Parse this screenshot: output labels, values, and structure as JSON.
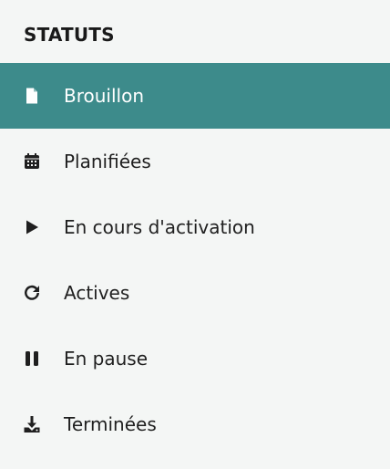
{
  "sidebar": {
    "title": "STATUTS",
    "items": [
      {
        "label": "Brouillon",
        "icon": "document-icon",
        "active": true
      },
      {
        "label": "Planifiées",
        "icon": "calendar-icon",
        "active": false
      },
      {
        "label": "En cours d'activation",
        "icon": "play-icon",
        "active": false
      },
      {
        "label": "Actives",
        "icon": "refresh-icon",
        "active": false
      },
      {
        "label": "En pause",
        "icon": "pause-icon",
        "active": false
      },
      {
        "label": "Terminées",
        "icon": "download-icon",
        "active": false
      }
    ]
  },
  "colors": {
    "background": "#f4f6f5",
    "active_background": "#3d8b8b",
    "active_text": "#ffffff",
    "text": "#1f1f1f"
  }
}
